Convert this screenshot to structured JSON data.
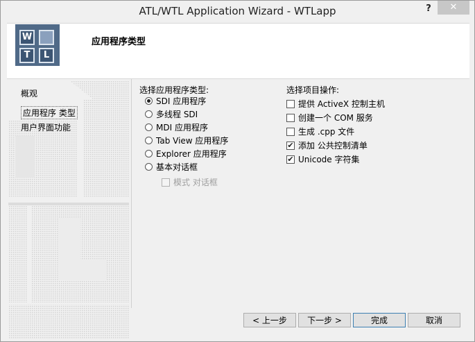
{
  "window": {
    "title": "ATL/WTL Application Wizard - WTLapp",
    "help_label": "?",
    "close_label": "✕"
  },
  "header": {
    "title": "应用程序类型",
    "logo_letters": [
      "W",
      "T",
      "L"
    ]
  },
  "nav": {
    "items": [
      {
        "label": "概观"
      },
      {
        "label": "应用程序 类型"
      },
      {
        "label": "用户界面功能"
      }
    ]
  },
  "app_type": {
    "heading": "选择应用程序类型:",
    "options": [
      {
        "label": "SDI 应用程序",
        "selected": true
      },
      {
        "label": "多线程  SDI",
        "selected": false
      },
      {
        "label": "MDI 应用程序",
        "selected": false
      },
      {
        "label": "Tab View 应用程序",
        "selected": false
      },
      {
        "label": "Explorer 应用程序",
        "selected": false
      },
      {
        "label": "基本对话框",
        "selected": false
      }
    ],
    "modal_dialog_label": "模式 对话框"
  },
  "project_ops": {
    "heading": "选择项目操作:",
    "options": [
      {
        "label": "提供  ActiveX 控制主机",
        "checked": false
      },
      {
        "label": "创建一个  COM 服务",
        "checked": false
      },
      {
        "label": "生成  .cpp 文件",
        "checked": false
      },
      {
        "label": "添加  公共控制清单",
        "checked": true
      },
      {
        "label": "Unicode 字符集",
        "checked": true
      }
    ]
  },
  "buttons": {
    "prev": "< 上一步",
    "next": "下一步 >",
    "finish": "完成",
    "cancel": "取消"
  },
  "check_mark": "✔"
}
